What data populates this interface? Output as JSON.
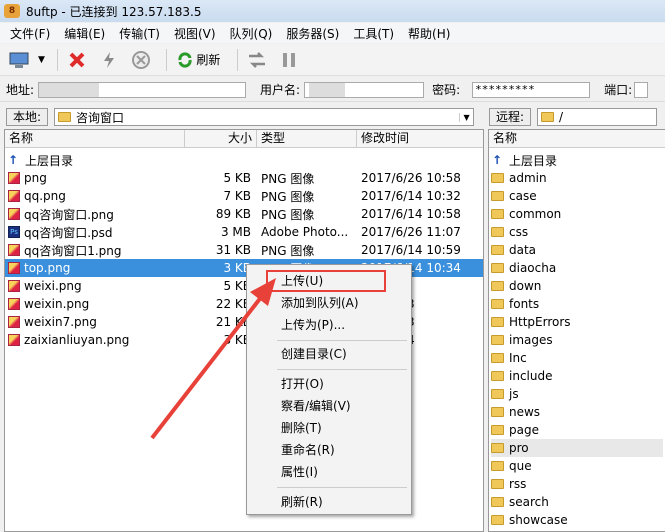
{
  "title": "8uftp - 已连接到 123.57.183.5",
  "menu": [
    "文件(F)",
    "编辑(E)",
    "传输(T)",
    "视图(V)",
    "队列(Q)",
    "服务器(S)",
    "工具(T)",
    "帮助(H)"
  ],
  "toolbar": {
    "refresh": "刷新"
  },
  "addr": {
    "address_label": "地址:",
    "user_label": "用户名:",
    "password_label": "密码:",
    "password_value": "*********",
    "port_label": "端口:"
  },
  "local": {
    "label": "本地:",
    "path": "咨询窗口",
    "headers": {
      "name": "名称",
      "size": "大小",
      "type": "类型",
      "modified": "修改时间"
    },
    "parent": "上层目录",
    "files": [
      {
        "name": "png",
        "size": "5 KB",
        "type": "PNG 图像",
        "modified": "2017/6/26 10:58",
        "icon": "png"
      },
      {
        "name": "qq.png",
        "size": "7 KB",
        "type": "PNG 图像",
        "modified": "2017/6/14 10:32",
        "icon": "png"
      },
      {
        "name": "qq咨询窗口.png",
        "size": "89 KB",
        "type": "PNG 图像",
        "modified": "2017/6/14 10:58",
        "icon": "png"
      },
      {
        "name": "qq咨询窗口.psd",
        "size": "3 MB",
        "type": "Adobe Photo...",
        "modified": "2017/6/26 11:07",
        "icon": "psd"
      },
      {
        "name": "qq咨询窗口1.png",
        "size": "31 KB",
        "type": "PNG 图像",
        "modified": "2017/6/14 10:59",
        "icon": "png"
      },
      {
        "name": "top.png",
        "size": "3 KB",
        "type": "PNG 图像",
        "modified": "2017/6/14 10:34",
        "icon": "png"
      },
      {
        "name": "weixi.png",
        "size": "5 KB",
        "type": "",
        "modified": "10:33",
        "icon": "png"
      },
      {
        "name": "weixin.png",
        "size": "22 KB",
        "type": "",
        "modified": "27 17:33",
        "icon": "png"
      },
      {
        "name": "weixin7.png",
        "size": "21 KB",
        "type": "",
        "modified": "27 17:33",
        "icon": "png"
      },
      {
        "name": "zaixianliuyan.png",
        "size": "3 KB",
        "type": "",
        "modified": "14 10:34",
        "icon": "png"
      }
    ]
  },
  "remote": {
    "label": "远程:",
    "path": "/",
    "headers": {
      "name": "名称"
    },
    "parent": "上层目录",
    "dirs": [
      "admin",
      "case",
      "common",
      "css",
      "data",
      "diaocha",
      "down",
      "fonts",
      "HttpErrors",
      "images",
      "Inc",
      "include",
      "js",
      "news",
      "page",
      "pro",
      "que",
      "rss",
      "search",
      "showcase"
    ]
  },
  "context_menu": {
    "items": [
      "上传(U)",
      "添加到队列(A)",
      "上传为(P)...",
      "创建目录(C)",
      "打开(O)",
      "察看/编辑(V)",
      "删除(T)",
      "重命名(R)",
      "属性(I)",
      "刷新(R)"
    ]
  },
  "colors": {
    "selection": "#3a90dd",
    "highlight": "#e8413a"
  }
}
